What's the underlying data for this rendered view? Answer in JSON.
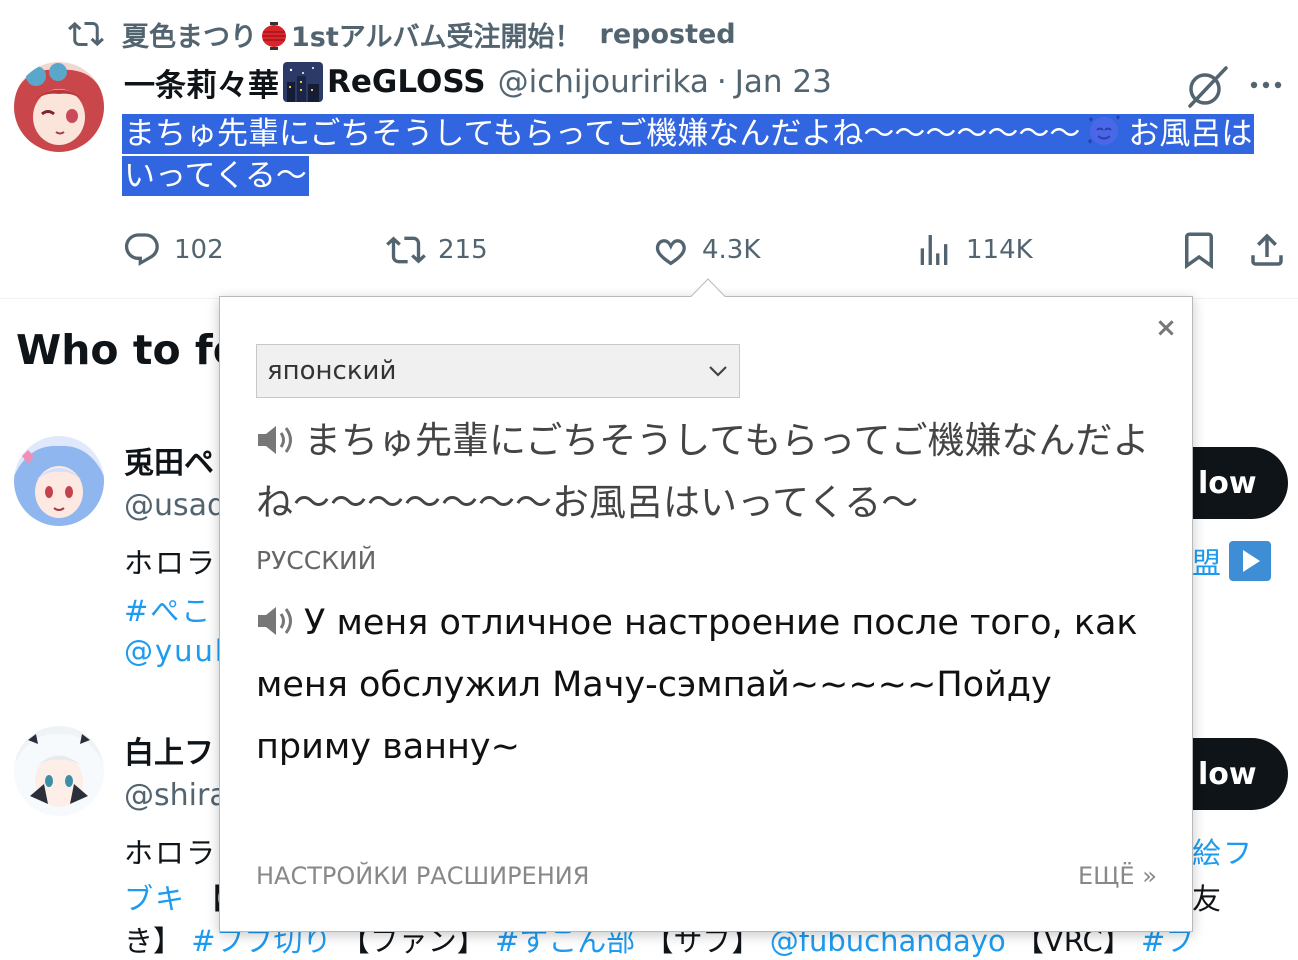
{
  "tweet": {
    "repost_by": "夏色まつり",
    "repost_album": "1stアルバム受注開始！",
    "repost_suffix": "reposted",
    "author_name": "一条莉々華",
    "author_group": "ReGLOSS",
    "author_handle": "@ichijouririka",
    "date_sep": "·",
    "date": "Jan 23",
    "text_part1": "まちゅ先輩にごちそうしてもらってご機嫌なんだよね〜〜〜〜〜〜〜",
    "text_part2": "お風呂はいってくる〜",
    "replies": "102",
    "reposts": "215",
    "likes": "4.3K",
    "views": "114K"
  },
  "who_to_follow": {
    "title": "Who to fo",
    "items": [
      {
        "name": "兎田ペ",
        "handle": "@usad",
        "bio_line1_start": "ホロラ",
        "bio_line1_end": "盟",
        "bio_line2": "#ぺこ",
        "bio_line3": "@yuuk",
        "follow_label": "low"
      },
      {
        "name": "白上フ",
        "handle": "@shira",
        "bio_line1_start": "ホロラ",
        "bio_line1_end": "絵フ",
        "bio_line2_start": "ブキ",
        "bio_line2_mid": "【",
        "bio_line2_end": "友",
        "bio_line3_a": "き】",
        "bio_line3_b": "#フブ切り",
        "bio_line3_c": "【ファン】",
        "bio_line3_d": "#すこん部",
        "bio_line3_e": "【サブ】",
        "bio_line3_f": "@fubuchandayo",
        "bio_line3_g": "【VRC】",
        "bio_line3_h": "#フ",
        "follow_label": "low"
      }
    ]
  },
  "translator": {
    "source_language": "японский",
    "source_text": "まちゅ先輩にごちそうしてもらってご機嫌なんだよね〜〜〜〜〜〜〜お風呂はいってくる〜",
    "target_language": "РУССКИЙ",
    "target_text": "У меня отличное настроение после того, как меня обслужил Мачу-сэмпай~~~~~Пойду приму ванну~",
    "settings_link": "НАСТРОЙКИ РАСШИРЕНИЯ",
    "more_link": "ЕЩЁ »",
    "close_glyph": "×"
  },
  "colors": {
    "selection": "#3166e0",
    "secondary_text": "#536471",
    "link": "#1d9bf0",
    "follow_button": "#0f1419"
  }
}
